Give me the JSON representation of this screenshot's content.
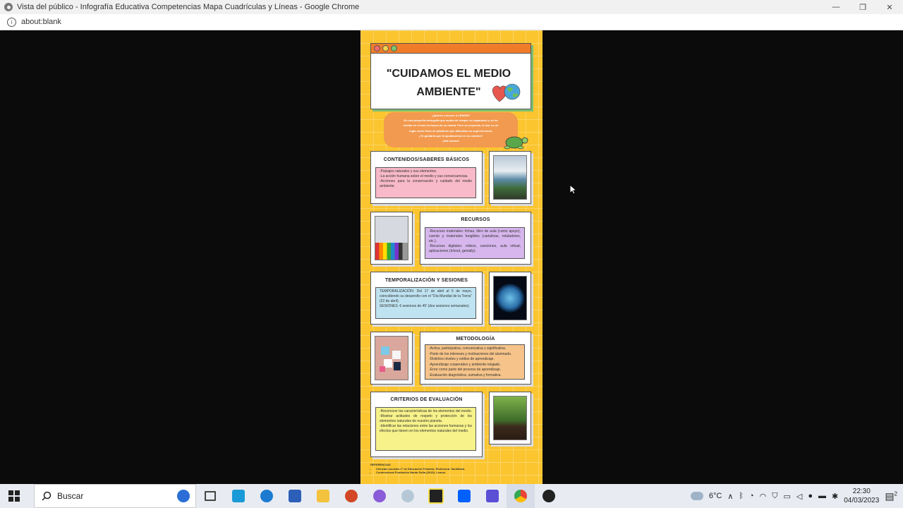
{
  "window": {
    "title": "Vista del público - Infografía Educativa Competencias Mapa Cuadrículas y Líneas - Google Chrome",
    "minimize": "—",
    "restore": "❐",
    "close": "✕"
  },
  "address": {
    "url": "about:blank"
  },
  "poster": {
    "title": "\"CUIDAMOS EL MEDIO AMBIENTE\"",
    "intro": [
      "¿Querés conocer a LEMON?",
      "Es una pequeña tortuguita que acaba de romper su caparazón y se ha",
      "metido en el mar en busca de su mamá. Pero su sorpresa, el mar es un",
      "lugar socio lleno de plásticos que dificultan su supervivencia.",
      "¿Te gustaría que la ayudásemos en su camino?",
      "¡Allá vamos!"
    ],
    "contenidos": {
      "title": "CONTENIDOS/SABERES BÁSICOS",
      "lines": [
        "-Paisajes naturales y sus elementos.",
        "-La acción humana sobre el medio y sus consecuencias.",
        "-Acciones para la conservación y cuidado del medio ambiente."
      ]
    },
    "recursos": {
      "title": "RECURSOS",
      "lines": [
        "-Recursos materiales: fichas, libro de aula (como apoyo), cuento y materiales fungibles (cartulinas, rotuladores, etc.).",
        "-Recursos digitales: vídeos, canciones, aula virtual, aplicaciones (Ichoot, genially)."
      ]
    },
    "temporalizacion": {
      "title": "TEMPORALIZACIÓN Y SESIONES",
      "lines": [
        "TEMPORALIZACIÓN: Del 17 de abril al 5 de mayo, coincidiendo su desarrollo con el \"Día Mundial de la Tierra\" (22 de abril).",
        "SESIONES: 6 sesiones de 45' (dos sesiones semanales)."
      ]
    },
    "metodologia": {
      "title": "METODOLOGÍA",
      "lines": [
        "-Activa, participativa, comunicativa y significativa.",
        "-Parte de los intereses y motivaciones del alumnado.",
        "-Distintos niveles y estilos de aprendizaje.",
        "-Aprendizaje cooperativo y ambiente relajado.",
        "-Error como parte del proceso de aprendizaje.",
        "-Evaluación diagnóstica, sumativa y formativa."
      ]
    },
    "criterios": {
      "title": "CRITERIOS DE EVALUACIÓN",
      "lines": [
        "-Reconocer las características de los elementos del medio.",
        "-Mostrar actitudes de respeto y protección de los elementos naturales de nuestro planeta.",
        "-Identificar las relaciones entre las acciones humanas y los efectos que tienen en los elementos naturales del medio."
      ]
    },
    "referencias": {
      "title": "REFERENCIAS",
      "items": [
        "Ciencias sociales 1º de Educación Primaria. Richmond. Santillana.",
        "Contenedoral Fundación Nanta Sofia (2019). Lemon."
      ]
    }
  },
  "taskbar": {
    "search_label": "Buscar",
    "weather": "6°C",
    "time": "22:30",
    "date": "04/03/2023",
    "notifications": "2"
  },
  "colors": {
    "poster_bg": "#fbc52f",
    "header_bar": "#f07c2a",
    "contenidos_box": "#f8b9c8",
    "recursos_box": "#d6b6ec",
    "temporalizacion_box": "#bfe3f1",
    "metodologia_box": "#f6c48a",
    "criterios_box": "#f7f28a"
  }
}
